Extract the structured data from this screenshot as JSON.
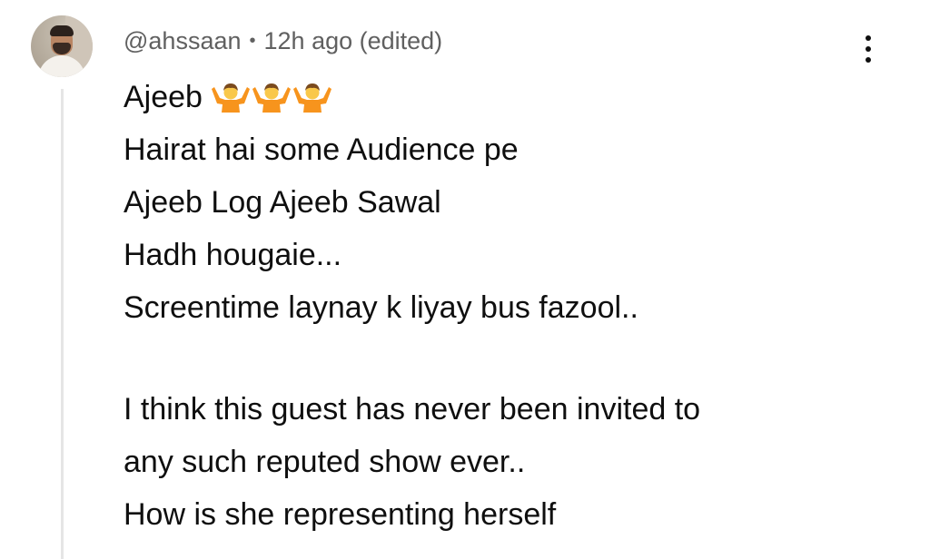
{
  "comment": {
    "author": "@ahssaan",
    "separator": "•",
    "time": "12h ago (edited)",
    "lines": [
      "Ajeeb",
      "Hairat hai some Audience pe",
      "Ajeeb Log Ajeeb Sawal",
      "Hadh hougaie...",
      "Screentime laynay k liyay bus fazool..",
      "",
      "I think this guest has never been invited to",
      "any such reputed show ever..",
      "How is she representing herself"
    ],
    "emojis": [
      "person-shrugging-emoji",
      "person-shrugging-emoji",
      "person-shrugging-emoji"
    ]
  },
  "menu": {
    "icon": "more-vertical-icon"
  },
  "colors": {
    "text": "#0f0f0f",
    "meta": "#606060",
    "thread_line": "#e5e5e5",
    "emoji_orange": "#f7941d"
  }
}
